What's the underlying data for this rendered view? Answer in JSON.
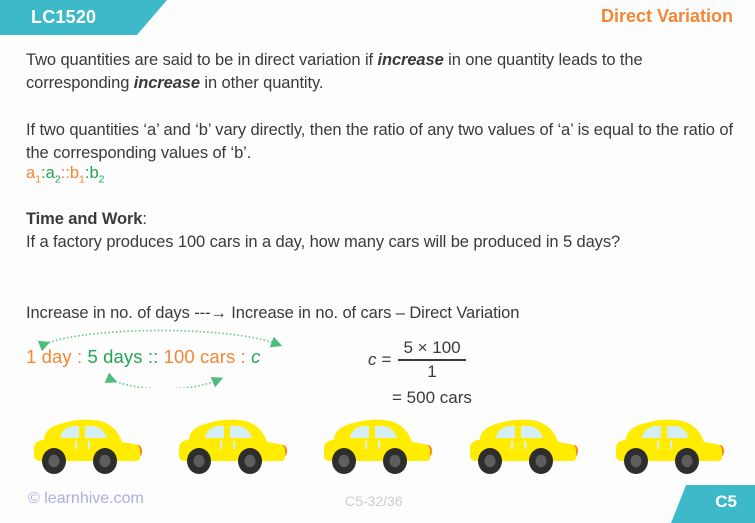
{
  "header": {
    "tag_label": "LC1520",
    "title": "Direct Variation",
    "tag_color": "#3db9c9",
    "title_color": "#f58634"
  },
  "body": {
    "paragraph1_part1": "Two quantities are said to be in direct variation if ",
    "paragraph1_emph1": "increase",
    "paragraph1_part2": " in one quantity leads to the corresponding ",
    "paragraph1_emph2": "increase",
    "paragraph1_part3": " in other quantity.",
    "paragraph2": "If two quantities ‘a’ and ‘b’ vary directly, then the ratio of any two values of ‘a’ is equal to the ratio of the corresponding values of ‘b’.",
    "ratio_notation": {
      "a1_base": "a",
      "a1_sub": "1",
      "colon1": ":",
      "a2_base": "a",
      "a2_sub": "2",
      "colon2": "::",
      "b1_base": "b",
      "b1_sub": "1",
      "colon3": ":",
      "b2_base": "b",
      "b2_sub": "2",
      "orange": "#f58634",
      "green": "#23a455"
    },
    "section_heading": "Time and Work",
    "section_heading_colon": ":",
    "question": "If a factory produces 100 cars in a day, how many cars will be produced in 5 days?",
    "relation_line": "Increase in no. of days ---→ Increase in no. of cars – Direct Variation"
  },
  "proportion": {
    "term1": "1 day",
    "sep1": " : ",
    "term2": "5 days",
    "sep2": " :: ",
    "term3": "100 cars",
    "sep3": " : ",
    "term4": "c",
    "arrow_color": "#4cbd7d"
  },
  "equation": {
    "variable": "c",
    "equals": "=",
    "numerator": "5 × 100",
    "denominator": "1",
    "result_equals": "=",
    "result": "500 cars"
  },
  "cars": {
    "count": 5,
    "body_color": "#ffec00",
    "window_color": "#d3eef5",
    "tyre_color": "#2e2e2e",
    "hub_color": "#5e5e5e",
    "taillight_color": "#ff8a1e",
    "positions": [
      30,
      175,
      320,
      466,
      612
    ]
  },
  "footer": {
    "copyright": "© learnhive.com",
    "page_code": "C5-32/36",
    "badge_label": "C5",
    "copyright_color": "#b0aede",
    "badge_color": "#3db9c9"
  }
}
